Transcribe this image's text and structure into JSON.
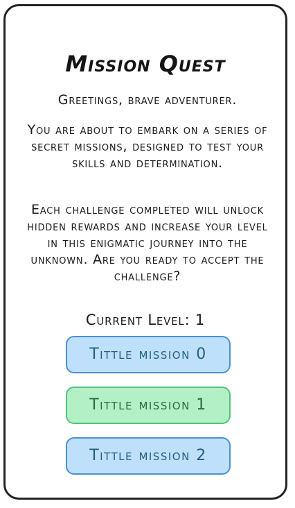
{
  "title": "Mission Quest",
  "greeting": "Greetings, brave adventurer.",
  "intro": "You are about to embark on a series of secret missions, designed to test your skills and determination.",
  "challenge_text": "Each challenge completed will unlock hidden rewards and increase your level in this enigmatic journey into the unknown. Are you ready to accept the challenge?",
  "level_label": "Current Level: 1",
  "missions": [
    {
      "label": "Tittle mission 0",
      "color": "#bfe0fb"
    },
    {
      "label": "Tittle mission 1",
      "color": "#b4f0c6"
    },
    {
      "label": "Tittle mission 2",
      "color": "#bfe0fb"
    }
  ],
  "colors": {
    "blue_button_bg": "#bfe0fb",
    "blue_button_border": "#4a90d6",
    "green_button_bg": "#b4f0c6",
    "green_button_border": "#4cc47a"
  }
}
